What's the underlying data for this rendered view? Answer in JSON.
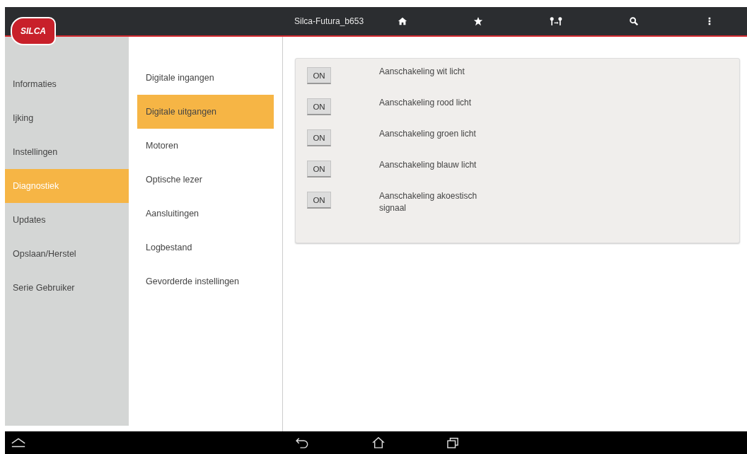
{
  "logo": "SILCA",
  "title": "Silca-Futura_b653",
  "toolbar": [
    {
      "kind": "home"
    },
    {
      "kind": "star"
    },
    {
      "kind": "keys"
    },
    {
      "kind": "search"
    },
    {
      "kind": "more"
    }
  ],
  "sidebar": {
    "items": [
      {
        "label": "Informaties",
        "selected": false
      },
      {
        "label": "Ijking",
        "selected": false
      },
      {
        "label": "Instellingen",
        "selected": false
      },
      {
        "label": "Diagnostiek",
        "selected": true
      },
      {
        "label": "Updates",
        "selected": false
      },
      {
        "label": "Opslaan/Herstel",
        "selected": false
      },
      {
        "label": "Serie Gebruiker",
        "selected": false
      }
    ]
  },
  "submenu": {
    "items": [
      {
        "label": "Digitale ingangen",
        "selected": false
      },
      {
        "label": "Digitale uitgangen",
        "selected": true
      },
      {
        "label": "Motoren",
        "selected": false
      },
      {
        "label": "Optische lezer",
        "selected": false
      },
      {
        "label": "Aansluitingen",
        "selected": false
      },
      {
        "label": "Logbestand",
        "selected": false
      },
      {
        "label": "Gevorderde instellingen",
        "selected": false
      }
    ]
  },
  "outputs": [
    {
      "button": "ON",
      "label": "Aanschakeling wit licht"
    },
    {
      "button": "ON",
      "label": "Aanschakeling rood licht"
    },
    {
      "button": "ON",
      "label": "Aanschakeling groen licht"
    },
    {
      "button": "ON",
      "label": "Aanschakeling blauw licht"
    },
    {
      "button": "ON",
      "label": "Aanschakeling akoestisch signaal"
    }
  ],
  "navbar": [
    {
      "kind": "up"
    },
    {
      "kind": "back"
    },
    {
      "kind": "home"
    },
    {
      "kind": "recent"
    }
  ]
}
